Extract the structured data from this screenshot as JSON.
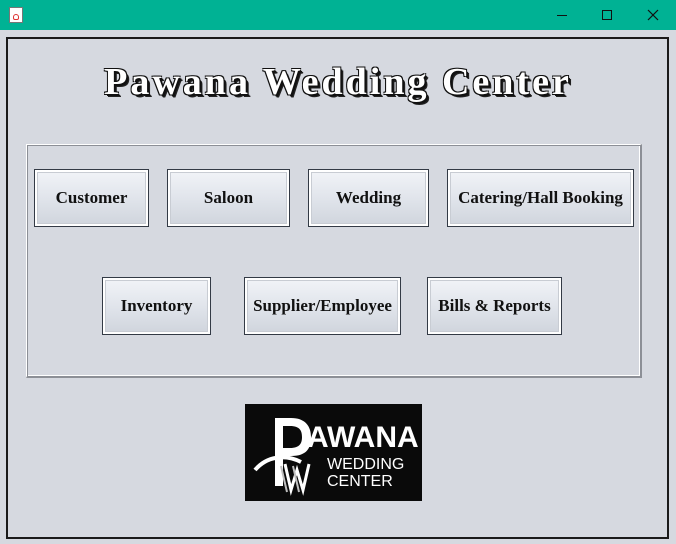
{
  "window": {
    "icon": "java-icon",
    "controls": [
      "minimize-icon",
      "maximize-icon",
      "close-icon"
    ]
  },
  "title": "Pawana Wedding Center",
  "buttons": {
    "customer": "Customer",
    "saloon": "Saloon",
    "wedding": "Wedding",
    "catering": "Catering/Hall Booking",
    "inventory": "Inventory",
    "supplier": "Supplier/Employee",
    "bills": "Bills & Reports"
  },
  "logo": {
    "brand": "AWANA",
    "line1": "WEDDING",
    "line2": "CENTER"
  },
  "colors": {
    "titlebar": "#00b294",
    "background": "#d6d9e0",
    "logo_background": "#0a0a0a"
  }
}
